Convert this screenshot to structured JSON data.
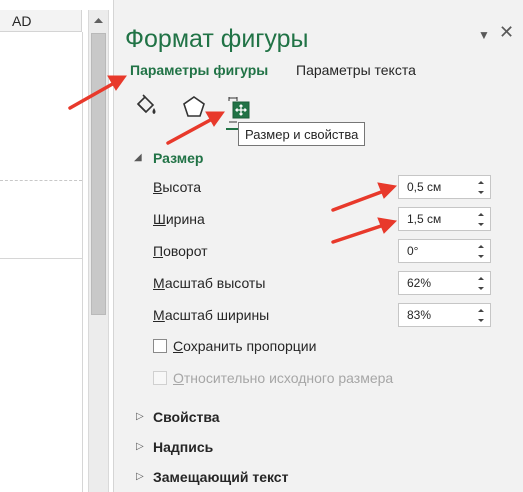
{
  "sheet": {
    "column_header": "AD"
  },
  "pane": {
    "title": "Формат фигуры",
    "menu_icon": "▼",
    "close_icon": "✕",
    "tabs": {
      "shape": "Параметры фигуры",
      "text": "Параметры текста"
    },
    "icons": [
      "fill-line-icon",
      "effects-pentagon-icon",
      "size-properties-icon"
    ],
    "tooltip": "Размер и свойства",
    "size_section": {
      "arrow": "◢",
      "label": "Размер",
      "rows": [
        {
          "label_first": "В",
          "label_rest": "ысота",
          "value": "0,5 см"
        },
        {
          "label_first": "Ш",
          "label_rest": "ирина",
          "value": "1,5 см"
        },
        {
          "label_first": "П",
          "label_rest": "оворот",
          "value": "0°"
        },
        {
          "label_first": "М",
          "label_rest": "асштаб высоты",
          "value": "62%"
        },
        {
          "label_first": "М",
          "label_rest": "асштаб ширины",
          "value": "83%"
        }
      ],
      "keep_proportions": {
        "label_first": "С",
        "label_rest": "охранить пропорции"
      },
      "relative_original": {
        "label_first": "О",
        "label_rest": "тносительно исходного размера"
      }
    },
    "collapsed_sections": [
      {
        "arrow": "▷",
        "label": "Свойства"
      },
      {
        "arrow": "▷",
        "label": "Надпись"
      },
      {
        "arrow": "▷",
        "label": "Замещающий текст"
      }
    ]
  },
  "colors": {
    "accent": "#217346",
    "annotation_arrow": "#e8392b",
    "pane_bg": "#f2f2f2"
  }
}
